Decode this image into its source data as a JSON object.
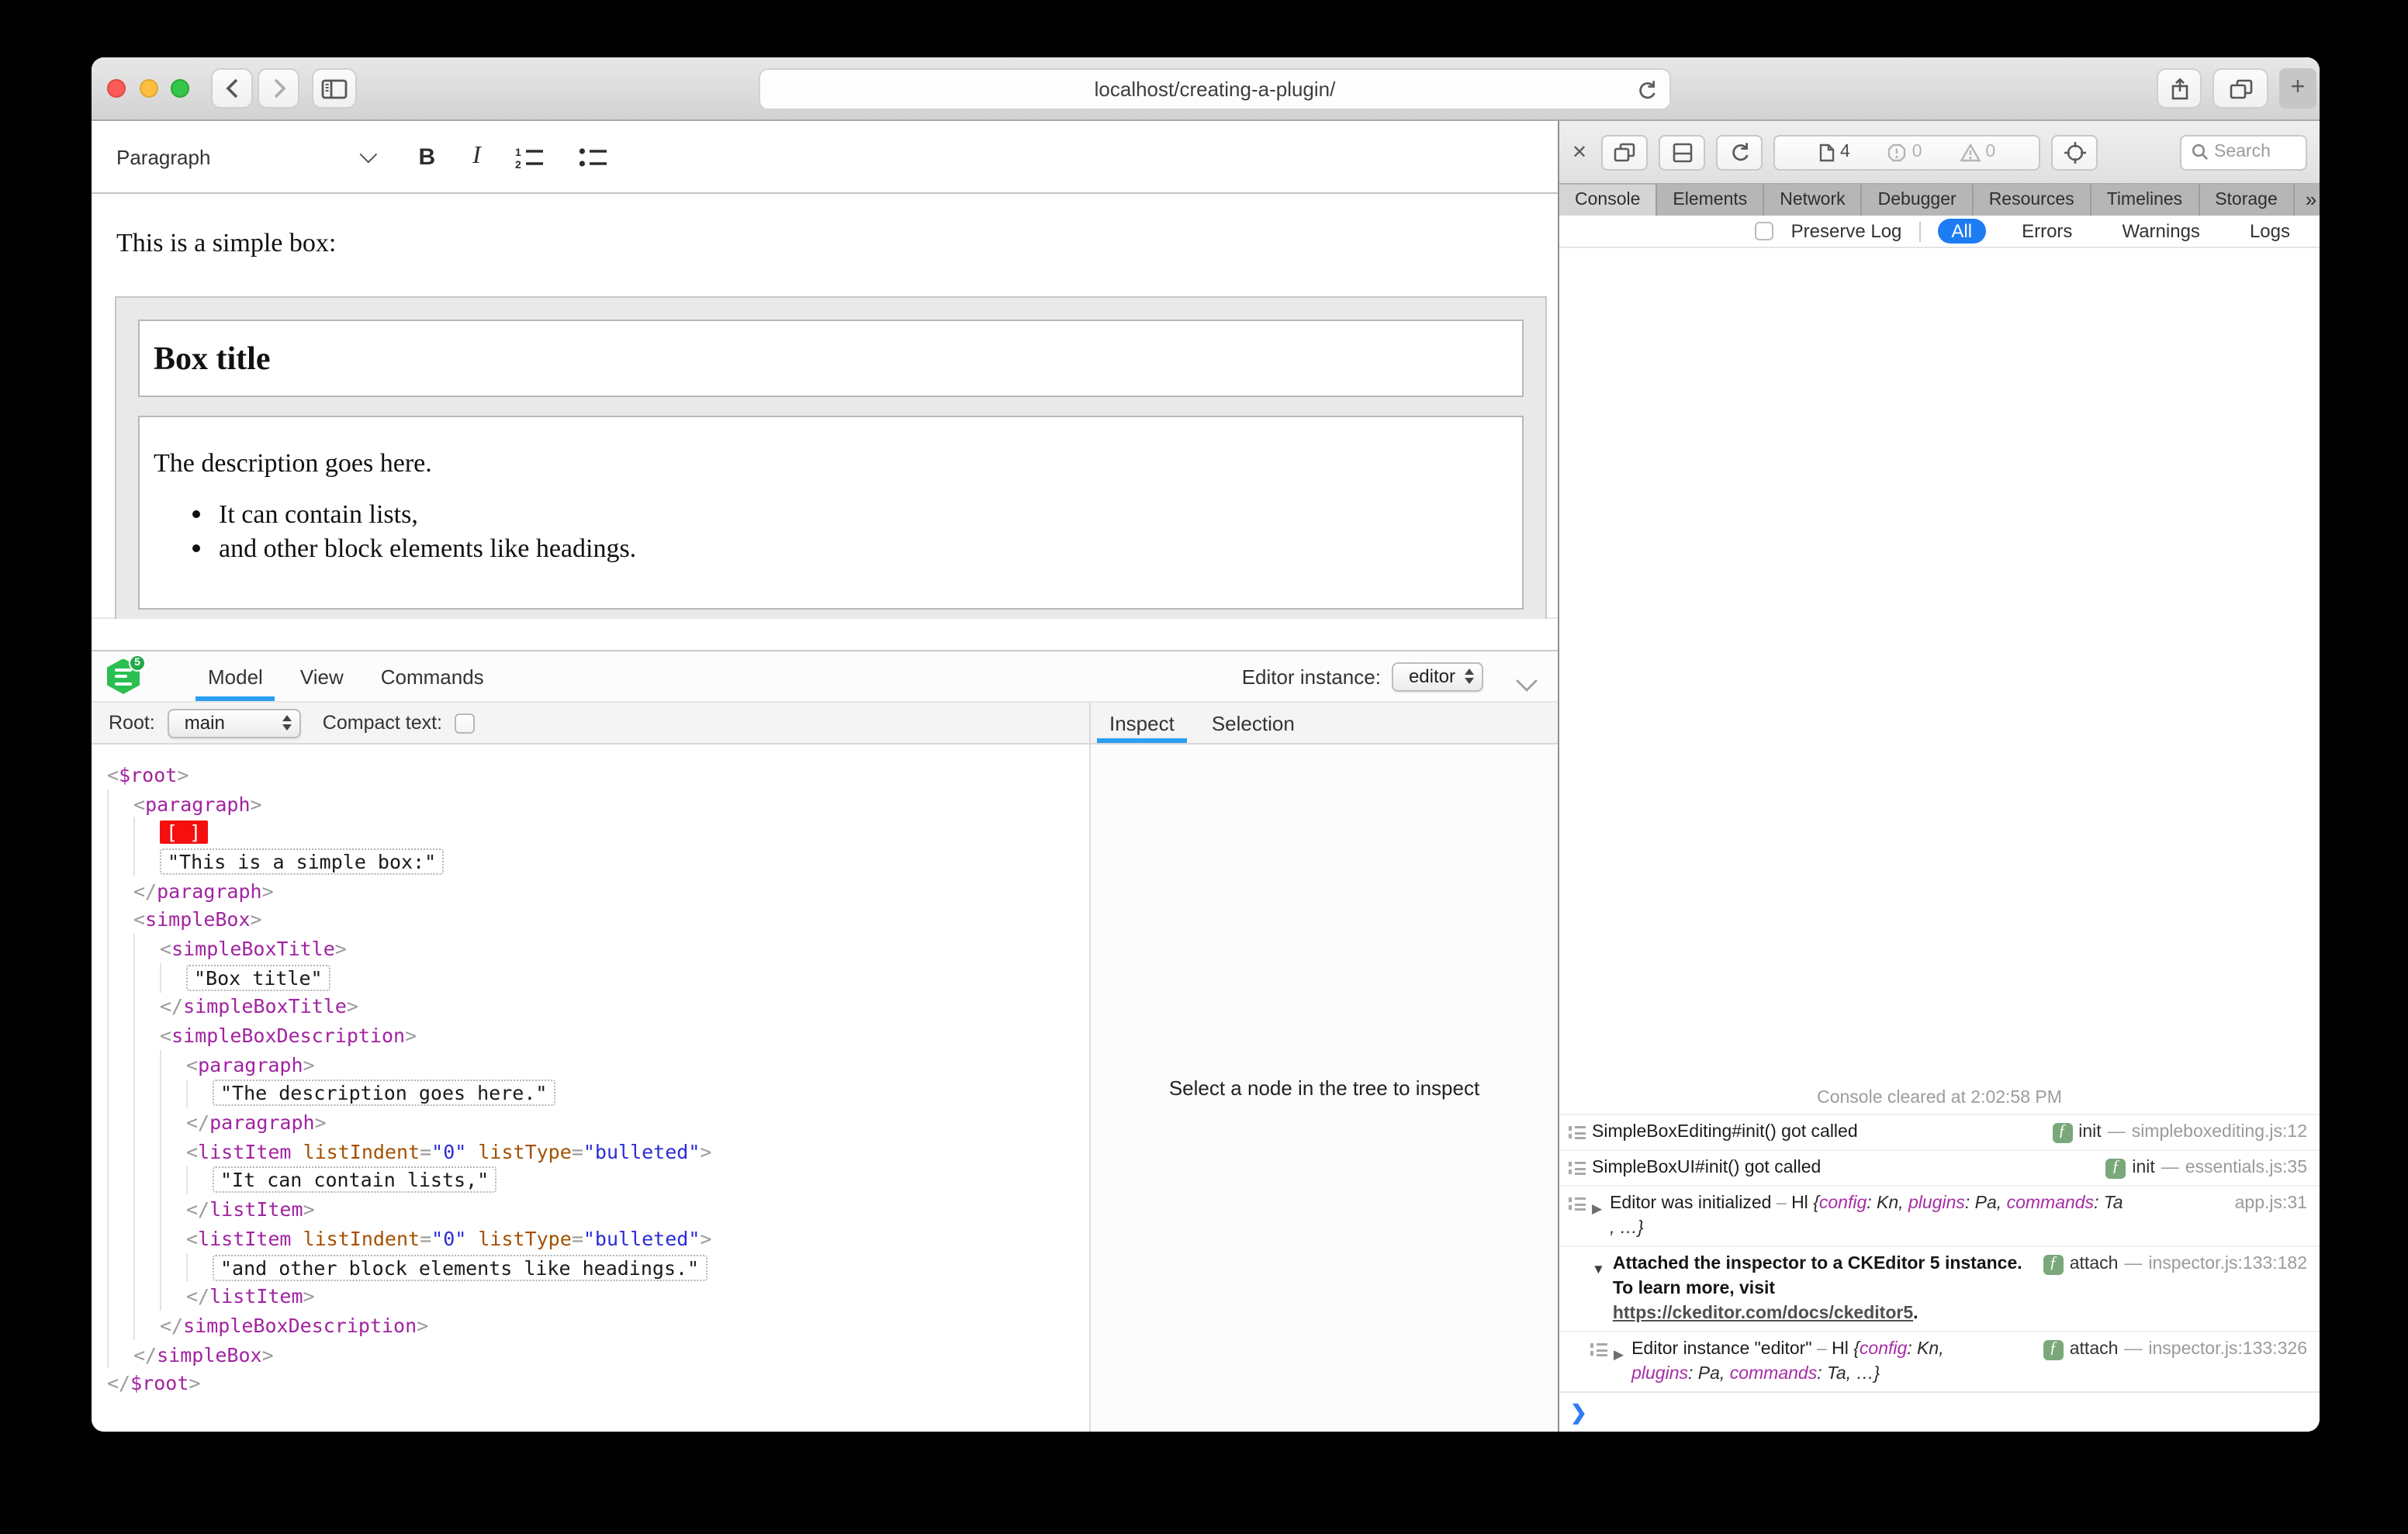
{
  "browser": {
    "url": "localhost/creating-a-plugin/",
    "new_tab_glyph": "+",
    "close_glyph": "✕"
  },
  "editor_toolbar": {
    "paragraph": "Paragraph",
    "bold": "B",
    "italic": "I"
  },
  "editor_content": {
    "intro": "This is a simple box:",
    "box_title": "Box title",
    "box_description": "The description goes here.",
    "box_list": [
      "It can contain lists,",
      "and other block elements like headings."
    ]
  },
  "inspector": {
    "logo_badge": "5",
    "tabs": [
      "Model",
      "View",
      "Commands"
    ],
    "active_tab": "Model",
    "editor_instance_label": "Editor instance:",
    "editor_instance": "editor",
    "root_label": "Root:",
    "root_value": "main",
    "compact_text_label": "Compact text:",
    "panel_tabs": [
      "Inspect",
      "Selection"
    ],
    "panel_active_tab": "Inspect",
    "panel_empty_message": "Select a node in the tree to inspect",
    "tree": [
      {
        "indent": 0,
        "kind": "open",
        "tag": "$root"
      },
      {
        "indent": 1,
        "kind": "open",
        "tag": "paragraph"
      },
      {
        "indent": 2,
        "kind": "selection",
        "label": "[ ]"
      },
      {
        "indent": 2,
        "kind": "text",
        "text": "This is a simple box:"
      },
      {
        "indent": 1,
        "kind": "close",
        "tag": "paragraph"
      },
      {
        "indent": 1,
        "kind": "open",
        "tag": "simpleBox"
      },
      {
        "indent": 2,
        "kind": "open",
        "tag": "simpleBoxTitle"
      },
      {
        "indent": 3,
        "kind": "text",
        "text": "Box title"
      },
      {
        "indent": 2,
        "kind": "close",
        "tag": "simpleBoxTitle"
      },
      {
        "indent": 2,
        "kind": "open",
        "tag": "simpleBoxDescription"
      },
      {
        "indent": 3,
        "kind": "open",
        "tag": "paragraph"
      },
      {
        "indent": 4,
        "kind": "text",
        "text": "The description goes here."
      },
      {
        "indent": 3,
        "kind": "close",
        "tag": "paragraph"
      },
      {
        "indent": 3,
        "kind": "open",
        "tag": "listItem",
        "attrs": [
          [
            "listIndent",
            "0"
          ],
          [
            "listType",
            "bulleted"
          ]
        ]
      },
      {
        "indent": 4,
        "kind": "text",
        "text": "It can contain lists,"
      },
      {
        "indent": 3,
        "kind": "close",
        "tag": "listItem"
      },
      {
        "indent": 3,
        "kind": "open",
        "tag": "listItem",
        "attrs": [
          [
            "listIndent",
            "0"
          ],
          [
            "listType",
            "bulleted"
          ]
        ]
      },
      {
        "indent": 4,
        "kind": "text",
        "text": "and other block elements like headings."
      },
      {
        "indent": 3,
        "kind": "close",
        "tag": "listItem"
      },
      {
        "indent": 2,
        "kind": "close",
        "tag": "simpleBoxDescription"
      },
      {
        "indent": 1,
        "kind": "close",
        "tag": "simpleBox"
      },
      {
        "indent": 0,
        "kind": "close",
        "tag": "$root"
      }
    ]
  },
  "webinspector": {
    "toolbar": {
      "page_count": "4",
      "error_count": "0",
      "warning_count": "0",
      "search_placeholder": "Search"
    },
    "tabs": [
      "Console",
      "Elements",
      "Network",
      "Debugger",
      "Resources",
      "Timelines",
      "Storage"
    ],
    "active_tab": "Console",
    "more_tabs_glyph": "»",
    "new_tab_glyph": "+",
    "filter_bar": {
      "preserve_log": "Preserve Log",
      "options": [
        "All",
        "Errors",
        "Warnings",
        "Logs"
      ],
      "active": "All"
    },
    "console": {
      "cleared_message": "Console cleared at 2:02:58 PM",
      "prompt_glyph": "❯",
      "messages": [
        {
          "icon": "log",
          "segments": [
            {
              "k": "t",
              "v": "SimpleBoxEditing#init() got called"
            }
          ],
          "badge": "init",
          "location": "simpleboxediting.js:12"
        },
        {
          "icon": "log",
          "segments": [
            {
              "k": "t",
              "v": "SimpleBoxUI#init() got called"
            }
          ],
          "badge": "init",
          "location": "essentials.js:35"
        },
        {
          "icon": "log",
          "disclosure": "collapsed",
          "segments": [
            {
              "k": "t",
              "v": "Editor was initialized "
            },
            {
              "k": "dim",
              "v": "– "
            },
            {
              "k": "t",
              "v": "Hl "
            },
            {
              "k": "pv",
              "v": "{"
            },
            {
              "k": "key",
              "v": "config"
            },
            {
              "k": "pv",
              "v": ": Kn, "
            },
            {
              "k": "key",
              "v": "plugins"
            },
            {
              "k": "pv",
              "v": ": Pa, "
            },
            {
              "k": "key",
              "v": "commands"
            },
            {
              "k": "pv",
              "v": ": Ta"
            },
            {
              "k": "br"
            },
            {
              "k": "pv",
              "v": ", …}"
            }
          ],
          "badge": null,
          "location": "app.js:31"
        },
        {
          "icon": null,
          "disclosure": "expanded",
          "bold": true,
          "segments": [
            {
              "k": "t",
              "v": "Attached the inspector to a CKEditor 5 instance. To learn more, visit "
            },
            {
              "k": "link",
              "v": "https://ckeditor.com/docs/ckeditor5"
            },
            {
              "k": "t",
              "v": "."
            }
          ],
          "badge": "attach",
          "location": "inspector.js:133:182"
        },
        {
          "icon": "log",
          "indent": true,
          "disclosure": "collapsed",
          "segments": [
            {
              "k": "t",
              "v": "Editor instance \"editor\" "
            },
            {
              "k": "dim",
              "v": "– "
            },
            {
              "k": "t",
              "v": "Hl "
            },
            {
              "k": "pv",
              "v": "{"
            },
            {
              "k": "key",
              "v": "config"
            },
            {
              "k": "pv",
              "v": ": Kn,"
            },
            {
              "k": "br"
            },
            {
              "k": "key",
              "v": "plugins"
            },
            {
              "k": "pv",
              "v": ": Pa, "
            },
            {
              "k": "key",
              "v": "commands"
            },
            {
              "k": "pv",
              "v": ": Ta, …}"
            }
          ],
          "badge": "attach",
          "location": "inspector.js:133:326"
        }
      ]
    }
  }
}
